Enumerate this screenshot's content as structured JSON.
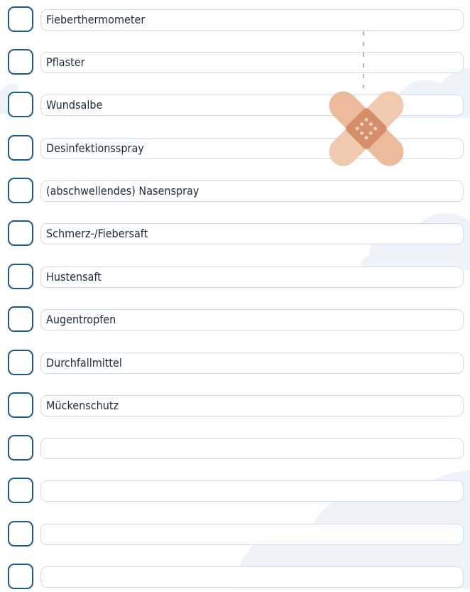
{
  "checklist": {
    "items": [
      {
        "label": "Fieberthermometer",
        "checked": false
      },
      {
        "label": "Pflaster",
        "checked": false
      },
      {
        "label": "Wundsalbe",
        "checked": false
      },
      {
        "label": "Desinfektionsspray",
        "checked": false
      },
      {
        "label": "(abschwellendes) Nasenspray",
        "checked": false
      },
      {
        "label": "Schmerz-/Fiebersaft",
        "checked": false
      },
      {
        "label": "Hustensaft",
        "checked": false
      },
      {
        "label": "Augentropfen",
        "checked": false
      },
      {
        "label": "Durchfallmittel",
        "checked": false
      },
      {
        "label": "Mückenschutz",
        "checked": false
      },
      {
        "label": "",
        "checked": false
      },
      {
        "label": "",
        "checked": false
      },
      {
        "label": "",
        "checked": false
      },
      {
        "label": "",
        "checked": false
      }
    ]
  },
  "decoration": {
    "bandage_icon": "bandage-icon",
    "cloud_icon": "cloud-icon"
  },
  "colors": {
    "checkbox_border": "#1b5a8c",
    "field_border": "#cfdcea",
    "cloud": "#eef3f9",
    "bandage_pad": "#d48e6c",
    "bandage_strip": "#f1c9ae"
  }
}
